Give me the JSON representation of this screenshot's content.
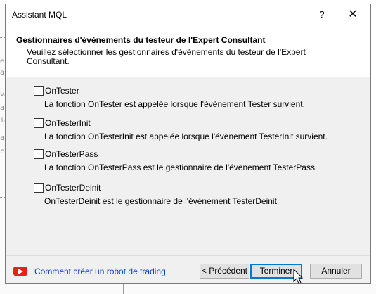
{
  "dialog": {
    "title": "Assistant MQL",
    "help_label": "?",
    "close_label": "✕"
  },
  "header": {
    "title": "Gestionnaires d'évènements du testeur de l'Expert Consultant",
    "description": "Veuillez sélectionner les gestionnaires d'évènements du testeur de l'Expert Consultant."
  },
  "handlers": [
    {
      "label": "OnTester",
      "checked": false,
      "description": "La fonction OnTester est appelée lorsque l'évènement Tester survient."
    },
    {
      "label": "OnTesterInit",
      "checked": false,
      "description": "La fonction OnTesterInit est appelée lorsque l'évènement TesterInit survient."
    },
    {
      "label": "OnTesterPass",
      "checked": false,
      "description": "La fonction OnTesterPass est le gestionnaire de l'évènement TesterPass."
    },
    {
      "label": "OnTesterDeinit",
      "checked": false,
      "description": "OnTesterDeinit est le gestionnaire de l'évènement TesterDeinit."
    }
  ],
  "footer": {
    "video_link": "Comment créer un robot de trading",
    "back_label": "< Précédent",
    "finish_label": "Terminer",
    "cancel_label": "Annuler"
  },
  "background": {
    "editor_chars": [
      "er",
      "ac",
      "va",
      "al",
      "ie",
      "ar",
      "ch"
    ]
  },
  "colors": {
    "link": "#0a3fd0",
    "youtube": "#e62117",
    "primary_border": "#0078d7"
  }
}
